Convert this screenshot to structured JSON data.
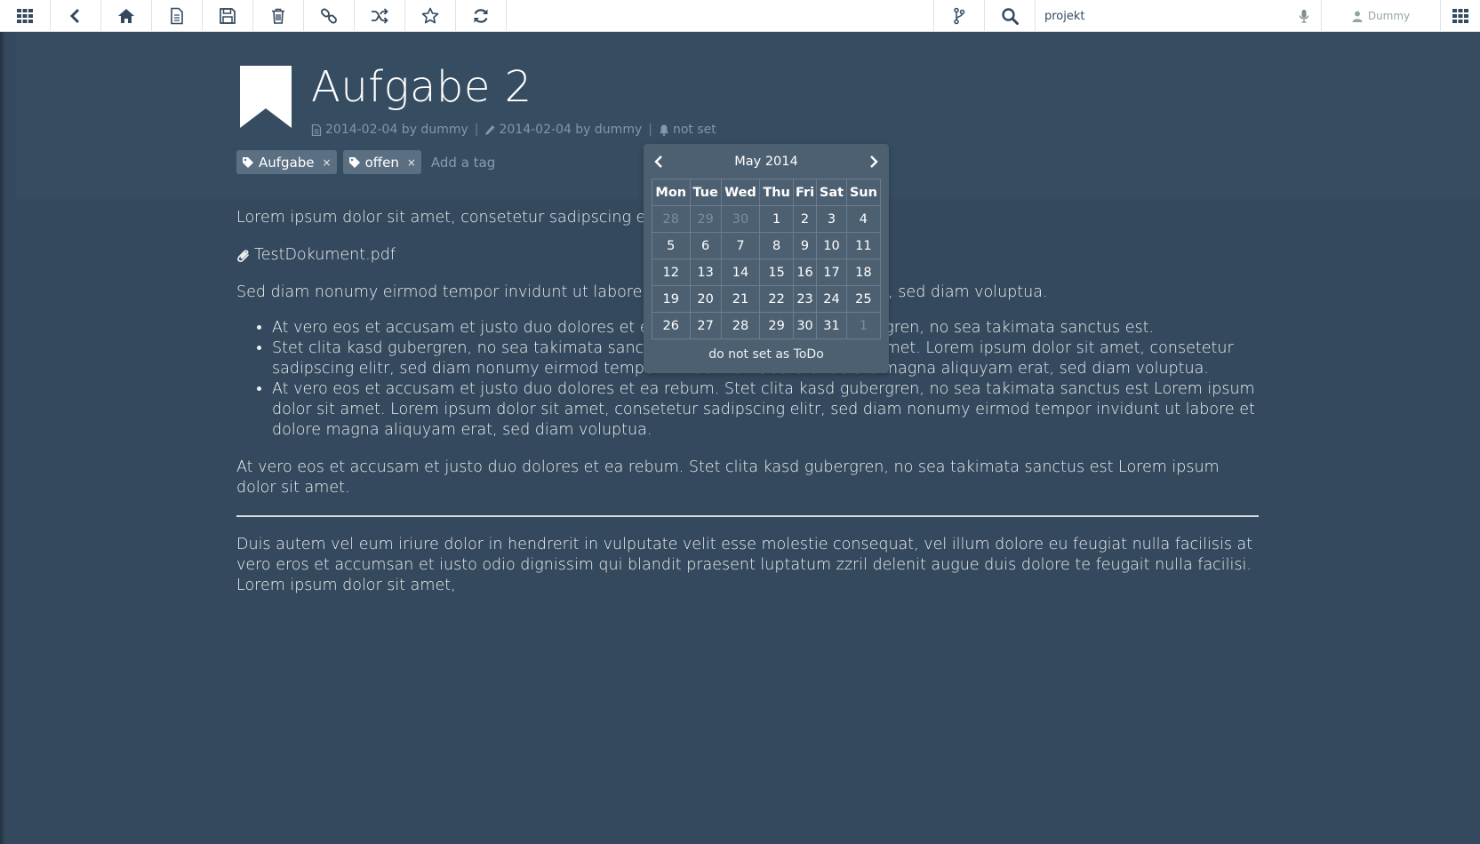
{
  "toolbar": {
    "search_value": "projekt",
    "user_name": "Dummy"
  },
  "document": {
    "title": "Aufgabe 2",
    "created": "2014-02-04 by dummy",
    "modified": "2014-02-04 by dummy",
    "reminder": "not set",
    "separator": "|"
  },
  "tags": {
    "items": [
      "Aufgabe",
      "offen"
    ],
    "remove": "×",
    "placeholder": "Add a tag"
  },
  "content": {
    "p1": "Lorem ipsum dolor sit amet, consetetur sadipscing elitr.",
    "attachment": "TestDokument.pdf",
    "p2": "Sed diam nonumy eirmod tempor invidunt ut labore et dolore magna aliquyam erat, sed diam voluptua.",
    "list": [
      "At vero eos et accusam et justo duo dolores et ea rebum. Stet clita kasd gubergren, no sea takimata sanctus est.",
      "Stet clita kasd gubergren, no sea takimata sanctus est Lorem ipsum dolor sit amet. Lorem ipsum dolor sit amet, consetetur sadipscing elitr, sed diam nonumy eirmod tempor invidunt ut labore et dolore magna aliquyam erat, sed diam voluptua.",
      "At vero eos et accusam et justo duo dolores et ea rebum. Stet clita kasd gubergren, no sea takimata sanctus est Lorem ipsum dolor sit amet. Lorem ipsum dolor sit amet, consetetur sadipscing elitr, sed diam nonumy eirmod tempor invidunt ut labore et dolore magna aliquyam erat, sed diam voluptua."
    ],
    "p3": "At vero eos et accusam et justo duo dolores et ea rebum. Stet clita kasd gubergren, no sea takimata sanctus est Lorem ipsum dolor sit amet.",
    "p4": "Duis autem vel eum iriure dolor in hendrerit in vulputate velit esse molestie consequat, vel illum dolore eu feugiat nulla facilisis at vero eros et accumsan et iusto odio dignissim qui blandit praesent luptatum zzril delenit augue duis dolore te feugait nulla facilisi. Lorem ipsum dolor sit amet,"
  },
  "datepicker": {
    "month_label": "May 2014",
    "weekdays": [
      "Mon",
      "Tue",
      "Wed",
      "Thu",
      "Fri",
      "Sat",
      "Sun"
    ],
    "weeks": [
      [
        {
          "d": "28",
          "m": true
        },
        {
          "d": "29",
          "m": true
        },
        {
          "d": "30",
          "m": true
        },
        {
          "d": "1"
        },
        {
          "d": "2"
        },
        {
          "d": "3"
        },
        {
          "d": "4"
        }
      ],
      [
        {
          "d": "5"
        },
        {
          "d": "6"
        },
        {
          "d": "7"
        },
        {
          "d": "8"
        },
        {
          "d": "9"
        },
        {
          "d": "10"
        },
        {
          "d": "11"
        }
      ],
      [
        {
          "d": "12"
        },
        {
          "d": "13"
        },
        {
          "d": "14"
        },
        {
          "d": "15"
        },
        {
          "d": "16"
        },
        {
          "d": "17"
        },
        {
          "d": "18"
        }
      ],
      [
        {
          "d": "19"
        },
        {
          "d": "20"
        },
        {
          "d": "21"
        },
        {
          "d": "22"
        },
        {
          "d": "23"
        },
        {
          "d": "24"
        },
        {
          "d": "25"
        }
      ],
      [
        {
          "d": "26"
        },
        {
          "d": "27"
        },
        {
          "d": "28"
        },
        {
          "d": "29"
        },
        {
          "d": "30"
        },
        {
          "d": "31"
        },
        {
          "d": "1",
          "m": true
        }
      ]
    ],
    "footer": "do not set as ToDo"
  },
  "colors": {
    "background": "#34495e",
    "toolbar": "#ffffff",
    "tag": "#5b6f83",
    "datepicker": "#4d6072"
  }
}
